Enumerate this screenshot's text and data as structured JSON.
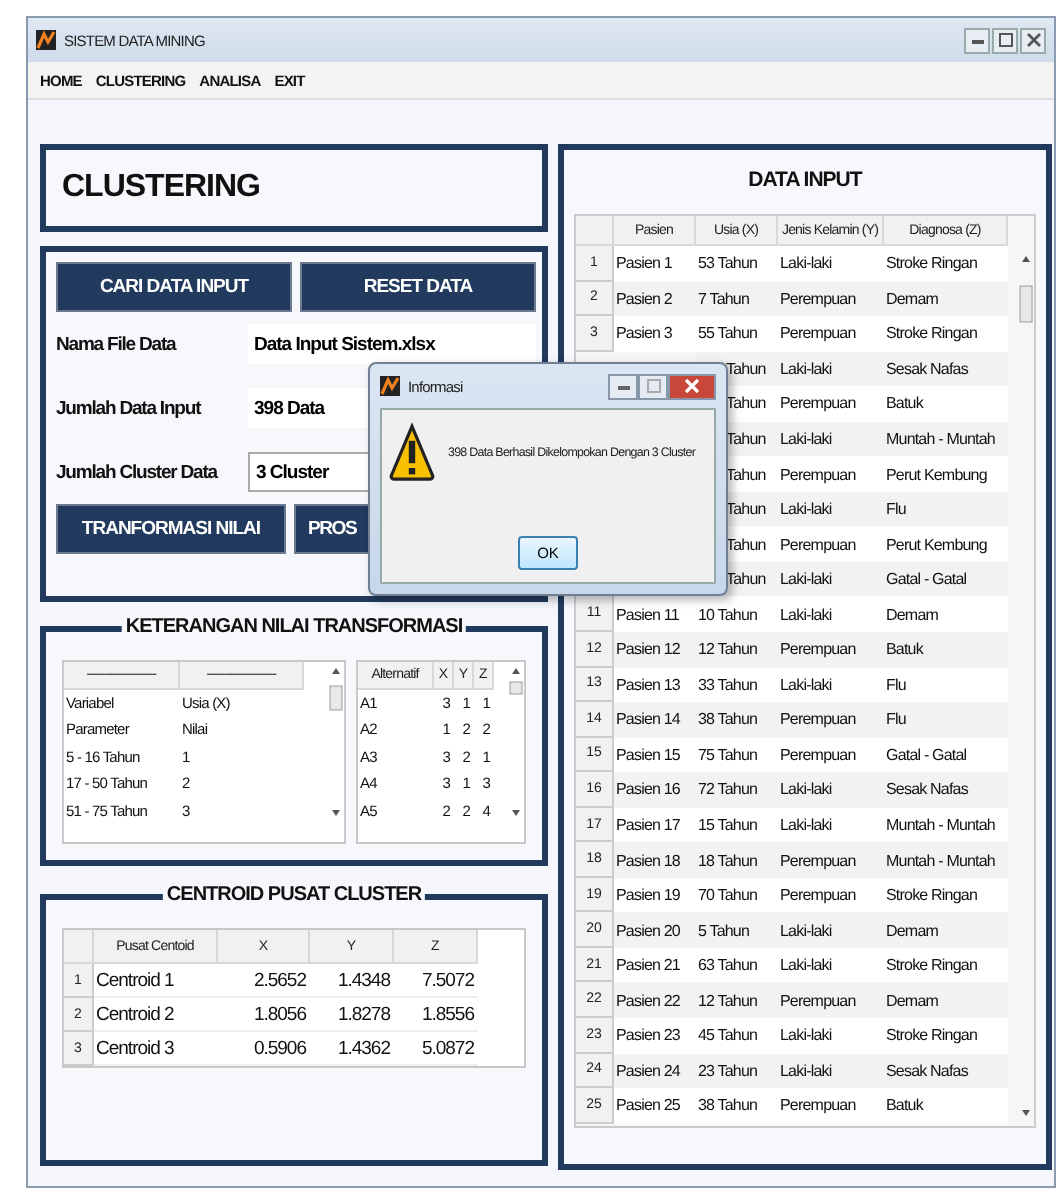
{
  "window": {
    "title": "SISTEM DATA MINING"
  },
  "menu": [
    "HOME",
    "CLUSTERING",
    "ANALISA",
    "EXIT"
  ],
  "header": {
    "title": "CLUSTERING"
  },
  "controls": {
    "buttons": [
      "CARI DATA INPUT",
      "RESET DATA"
    ],
    "fields": [
      {
        "label": "Nama File  Data",
        "value": "Data Input Sistem.xlsx",
        "kind": "text"
      },
      {
        "label": "Jumlah Data Input",
        "value": "398 Data",
        "kind": "text"
      },
      {
        "label": "Jumlah Cluster Data",
        "value": "3 Cluster",
        "kind": "dropdown"
      }
    ],
    "actions": [
      "TRANFORMASI NILAI",
      "PROS"
    ]
  },
  "transform_panel": {
    "title": "KETERANGAN NILAI TRANSFORMASI",
    "left_table": {
      "columns": [
        "--------------------",
        "--------------------"
      ],
      "rows": [
        [
          "Variabel",
          "Usia (X)"
        ],
        [
          "Parameter",
          "Nilai"
        ],
        [
          "5 - 16 Tahun",
          "1"
        ],
        [
          "17 - 50 Tahun",
          "2"
        ],
        [
          "51 - 75 Tahun",
          "3"
        ]
      ]
    },
    "right_table": {
      "columns": [
        "Alternatif",
        "X",
        "Y",
        "Z"
      ],
      "rows": [
        [
          "A1",
          "3",
          "1",
          "1"
        ],
        [
          "A2",
          "1",
          "2",
          "2"
        ],
        [
          "A3",
          "3",
          "2",
          "1"
        ],
        [
          "A4",
          "3",
          "1",
          "3"
        ],
        [
          "A5",
          "2",
          "2",
          "4"
        ]
      ]
    }
  },
  "centroid_panel": {
    "title": "CENTROID PUSAT CLUSTER",
    "columns": [
      "Pusat Centoid",
      "X",
      "Y",
      "Z"
    ],
    "rows": [
      {
        "no": "1",
        "cells": [
          "Centroid 1",
          "2.5652",
          "1.4348",
          "7.5072"
        ]
      },
      {
        "no": "2",
        "cells": [
          "Centroid 2",
          "1.8056",
          "1.8278",
          "1.8556"
        ]
      },
      {
        "no": "3",
        "cells": [
          "Centroid 3",
          "0.5906",
          "1.4362",
          "5.0872"
        ]
      }
    ]
  },
  "data_panel": {
    "title": "DATA INPUT",
    "columns": [
      "Pasien",
      "Usia (X)",
      "Jenis Kelamin (Y)",
      "Diagnosa (Z)"
    ],
    "rows": [
      {
        "no": "1",
        "cells": [
          "Pasien 1",
          "53 Tahun",
          "Laki-laki",
          "Stroke Ringan"
        ]
      },
      {
        "no": "2",
        "cells": [
          "Pasien 2",
          "7 Tahun",
          "Perempuan",
          "Demam"
        ]
      },
      {
        "no": "3",
        "cells": [
          "Pasien 3",
          "55 Tahun",
          "Perempuan",
          "Stroke Ringan"
        ]
      },
      {
        "no": null,
        "cells": [
          null,
          "Tahun",
          "Laki-laki",
          "Sesak Nafas"
        ]
      },
      {
        "no": null,
        "cells": [
          null,
          "Tahun",
          "Perempuan",
          "Batuk"
        ]
      },
      {
        "no": null,
        "cells": [
          null,
          "Tahun",
          "Laki-laki",
          "Muntah - Muntah"
        ]
      },
      {
        "no": null,
        "cells": [
          null,
          "Tahun",
          "Perempuan",
          "Perut Kembung"
        ]
      },
      {
        "no": null,
        "cells": [
          null,
          "Tahun",
          "Laki-laki",
          "Flu"
        ]
      },
      {
        "no": null,
        "cells": [
          null,
          "Tahun",
          "Perempuan",
          "Perut Kembung"
        ]
      },
      {
        "no": null,
        "cells": [
          null,
          "Tahun",
          "Laki-laki",
          "Gatal - Gatal"
        ]
      },
      {
        "no": "11",
        "cells": [
          "Pasien 11",
          "10 Tahun",
          "Laki-laki",
          "Demam"
        ]
      },
      {
        "no": "12",
        "cells": [
          "Pasien 12",
          "12 Tahun",
          "Perempuan",
          "Batuk"
        ]
      },
      {
        "no": "13",
        "cells": [
          "Pasien 13",
          "33 Tahun",
          "Laki-laki",
          "Flu"
        ]
      },
      {
        "no": "14",
        "cells": [
          "Pasien 14",
          "38 Tahun",
          "Perempuan",
          "Flu"
        ]
      },
      {
        "no": "15",
        "cells": [
          "Pasien 15",
          "75 Tahun",
          "Perempuan",
          "Gatal - Gatal"
        ]
      },
      {
        "no": "16",
        "cells": [
          "Pasien 16",
          "72 Tahun",
          "Laki-laki",
          "Sesak Nafas"
        ]
      },
      {
        "no": "17",
        "cells": [
          "Pasien 17",
          "15 Tahun",
          "Laki-laki",
          "Muntah - Muntah"
        ]
      },
      {
        "no": "18",
        "cells": [
          "Pasien 18",
          "18 Tahun",
          "Perempuan",
          "Muntah - Muntah"
        ]
      },
      {
        "no": "19",
        "cells": [
          "Pasien 19",
          "70 Tahun",
          "Perempuan",
          "Stroke Ringan"
        ]
      },
      {
        "no": "20",
        "cells": [
          "Pasien 20",
          "5 Tahun",
          "Laki-laki",
          "Demam"
        ]
      },
      {
        "no": "21",
        "cells": [
          "Pasien 21",
          "63 Tahun",
          "Laki-laki",
          "Stroke Ringan"
        ]
      },
      {
        "no": "22",
        "cells": [
          "Pasien 22",
          "12 Tahun",
          "Perempuan",
          "Demam"
        ]
      },
      {
        "no": "23",
        "cells": [
          "Pasien 23",
          "45 Tahun",
          "Laki-laki",
          "Stroke Ringan"
        ]
      },
      {
        "no": "24",
        "cells": [
          "Pasien 24",
          "23 Tahun",
          "Laki-laki",
          "Sesak Nafas"
        ]
      },
      {
        "no": "25",
        "cells": [
          "Pasien 25",
          "38 Tahun",
          "Perempuan",
          "Batuk"
        ]
      }
    ]
  },
  "dialog": {
    "title": "Informasi",
    "message": "398 Data Berhasil Dikelompokan Dengan 3 Cluster",
    "button": "OK"
  }
}
